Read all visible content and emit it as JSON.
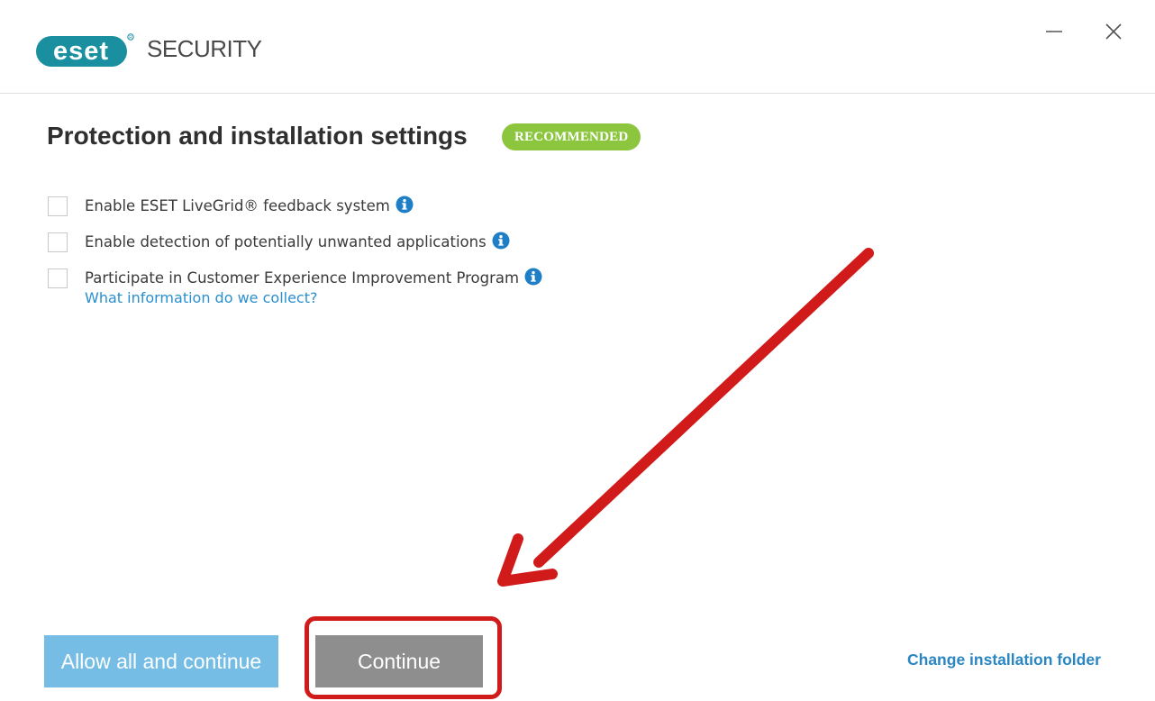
{
  "window": {
    "brand_logo_text": "eset",
    "product_name": "SECURITY",
    "controls": {
      "minimize_icon": "minimize-icon",
      "close_icon": "close-icon"
    }
  },
  "page": {
    "title": "Protection and installation settings",
    "badge": "RECOMMENDED"
  },
  "options": [
    {
      "label": "Enable ESET LiveGrid® feedback system",
      "checked": false,
      "icon": "info-icon"
    },
    {
      "label": "Enable detection of potentially unwanted applications",
      "checked": false,
      "icon": "info-icon"
    },
    {
      "label": "Participate in Customer Experience Improvement Program",
      "checked": false,
      "icon": "info-icon",
      "link": "What information do we collect?"
    }
  ],
  "footer": {
    "allow_all_label": "Allow all and continue",
    "continue_label": "Continue",
    "change_folder_label": "Change installation folder"
  },
  "colors": {
    "brand_teal": "#1a8fa0",
    "badge_green": "#8cc63f",
    "link_blue": "#2a8fce",
    "allow_button": "#75bde5",
    "continue_button": "#8e8e8e",
    "annotation_red": "#d11a1a"
  }
}
